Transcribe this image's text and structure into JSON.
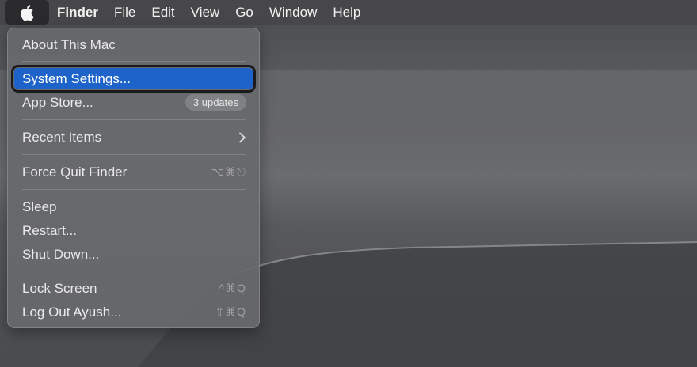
{
  "menubar": {
    "app_name": "Finder",
    "menus": [
      "File",
      "Edit",
      "View",
      "Go",
      "Window",
      "Help"
    ]
  },
  "apple_menu": {
    "about": "About This Mac",
    "system_settings": "System Settings...",
    "app_store": "App Store...",
    "app_store_badge": "3 updates",
    "recent_items": "Recent Items",
    "force_quit": "Force Quit Finder",
    "force_quit_shortcut": "⌥⌘⎋",
    "sleep": "Sleep",
    "restart": "Restart...",
    "shut_down": "Shut Down...",
    "lock_screen": "Lock Screen",
    "lock_screen_shortcut": "^⌘Q",
    "log_out": "Log Out Ayush...",
    "log_out_shortcut": "⇧⌘Q"
  },
  "colors": {
    "selection": "#1d63c9",
    "menu_background": "#68696d",
    "wallpaper": "#5f6064"
  }
}
